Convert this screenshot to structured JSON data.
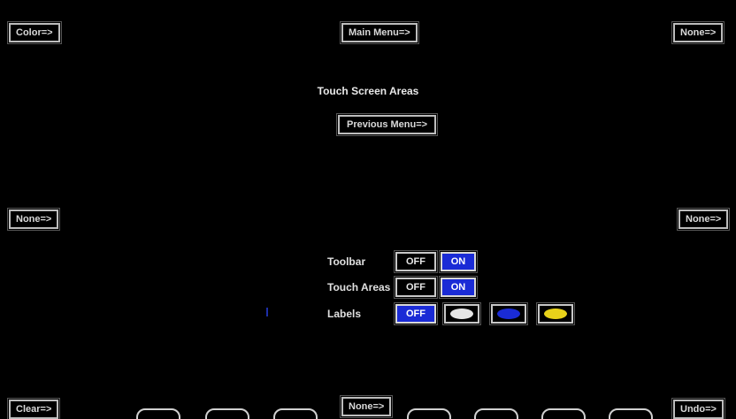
{
  "zones": {
    "top_left": "Color=>",
    "top_center": "Main Menu=>",
    "top_right": "None=>",
    "mid_left": "None=>",
    "mid_right": "None=>",
    "bottom_left": "Clear=>",
    "bottom_center": "None=>",
    "bottom_right": "Undo=>"
  },
  "menu": {
    "title": "Touch Screen Areas",
    "previous": "Previous Menu=>"
  },
  "options": {
    "toolbar": {
      "label": "Toolbar",
      "off": "OFF",
      "on": "ON",
      "selected": "ON"
    },
    "touch_areas": {
      "label": "Touch Areas",
      "off": "OFF",
      "on": "ON",
      "selected": "ON"
    },
    "labels": {
      "label": "Labels",
      "off": "OFF",
      "selected": "OFF",
      "swatches": [
        {
          "name": "white",
          "color": "#e6e6e6"
        },
        {
          "name": "blue",
          "color": "#1a2bd6"
        },
        {
          "name": "yellow",
          "color": "#e8d21a"
        }
      ]
    }
  },
  "colors": {
    "active": "#1a2bd6",
    "border": "#c8c8c8",
    "background": "#000000"
  }
}
